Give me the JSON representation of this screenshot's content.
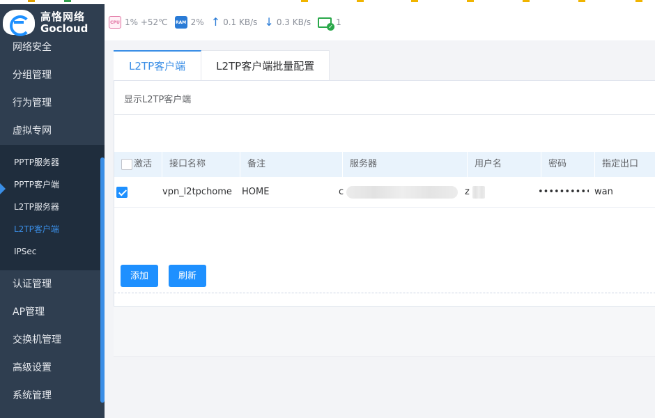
{
  "brand": {
    "name_cn": "高恪网络",
    "name_en": "Gocloud"
  },
  "status": {
    "cpu_chip": "CPU",
    "cpu": "1% +52℃",
    "ram_chip": "RAM",
    "ram": "2%",
    "upload": "0.1 KB/s",
    "download": "0.3 KB/s",
    "devices": "1"
  },
  "sidebar": {
    "items_top": [
      "网络安全",
      "分组管理",
      "行为管理",
      "虚拟专网"
    ],
    "submenu": [
      "PPTP服务器",
      "PPTP客户端",
      "L2TP服务器",
      "L2TP客户端",
      "IPSec"
    ],
    "active_sub": "L2TP客户端",
    "items_bottom": [
      "认证管理",
      "AP管理",
      "交换机管理",
      "高级设置",
      "系统管理"
    ]
  },
  "tabs": [
    "L2TP客户端",
    "L2TP客户端批量配置"
  ],
  "panel": {
    "title": "显示L2TP客户端"
  },
  "table": {
    "headers": [
      "激活",
      "接口名称",
      "备注",
      "服务器",
      "用户名",
      "密码",
      "指定出口"
    ],
    "rows": [
      {
        "active": true,
        "name": "vpn_l2tpchome",
        "remark": "HOME",
        "server": "c",
        "user": "z",
        "password": "••••••••••••",
        "exit": "wan"
      }
    ]
  },
  "buttons": {
    "add": "添加",
    "refresh": "刷新"
  },
  "colors": {
    "accent": "#1e90ff",
    "sidebar": "#2f3e50",
    "submenu": "#1f2d3d",
    "table_header": "#e9f3fc"
  }
}
